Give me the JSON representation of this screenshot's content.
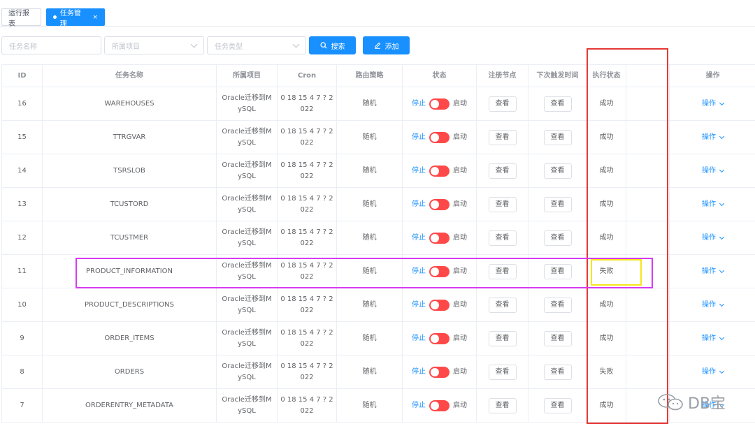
{
  "tabs": [
    {
      "label": "运行报表",
      "active": false
    },
    {
      "label": "任务管理",
      "active": true,
      "close": "×"
    }
  ],
  "filters": {
    "name_placeholder": "任务名称",
    "project_placeholder": "所属项目",
    "type_placeholder": "任务类型",
    "search_label": "搜索",
    "add_label": "添加"
  },
  "table": {
    "headers": {
      "id": "ID",
      "name": "任务名称",
      "project": "所属项目",
      "cron": "Cron",
      "route": "路由策略",
      "status": "状态",
      "reg": "注册节点",
      "next": "下次触发时间",
      "exec": "执行状态",
      "op": "操作"
    },
    "rows": [
      {
        "id": "16",
        "name": "WAREHOUSES",
        "project_l1": "Oracle迁移到M",
        "project_l2": "ySQL",
        "cron_l1": "0 18 15 4 7 ? 2",
        "cron_l2": "022",
        "route": "随机",
        "stop": "停止",
        "start": "启动",
        "reg": "查看",
        "next": "查看",
        "exec": "成功",
        "op": "操作"
      },
      {
        "id": "15",
        "name": "TTRGVAR",
        "project_l1": "Oracle迁移到M",
        "project_l2": "ySQL",
        "cron_l1": "0 18 15 4 7 ? 2",
        "cron_l2": "022",
        "route": "随机",
        "stop": "停止",
        "start": "启动",
        "reg": "查看",
        "next": "查看",
        "exec": "成功",
        "op": "操作"
      },
      {
        "id": "14",
        "name": "TSRSLOB",
        "project_l1": "Oracle迁移到M",
        "project_l2": "ySQL",
        "cron_l1": "0 18 15 4 7 ? 2",
        "cron_l2": "022",
        "route": "随机",
        "stop": "停止",
        "start": "启动",
        "reg": "查看",
        "next": "查看",
        "exec": "成功",
        "op": "操作"
      },
      {
        "id": "13",
        "name": "TCUSTORD",
        "project_l1": "Oracle迁移到M",
        "project_l2": "ySQL",
        "cron_l1": "0 18 15 4 7 ? 2",
        "cron_l2": "022",
        "route": "随机",
        "stop": "停止",
        "start": "启动",
        "reg": "查看",
        "next": "查看",
        "exec": "成功",
        "op": "操作"
      },
      {
        "id": "12",
        "name": "TCUSTMER",
        "project_l1": "Oracle迁移到M",
        "project_l2": "ySQL",
        "cron_l1": "0 18 15 4 7 ? 2",
        "cron_l2": "022",
        "route": "随机",
        "stop": "停止",
        "start": "启动",
        "reg": "查看",
        "next": "查看",
        "exec": "成功",
        "op": "操作"
      },
      {
        "id": "11",
        "name": "PRODUCT_INFORMATION",
        "project_l1": "Oracle迁移到M",
        "project_l2": "ySQL",
        "cron_l1": "0 18 15 4 7 ? 2",
        "cron_l2": "022",
        "route": "随机",
        "stop": "停止",
        "start": "启动",
        "reg": "查看",
        "next": "查看",
        "exec": "失败",
        "op": "操作"
      },
      {
        "id": "10",
        "name": "PRODUCT_DESCRIPTIONS",
        "project_l1": "Oracle迁移到M",
        "project_l2": "ySQL",
        "cron_l1": "0 18 15 4 7 ? 2",
        "cron_l2": "022",
        "route": "随机",
        "stop": "停止",
        "start": "启动",
        "reg": "查看",
        "next": "查看",
        "exec": "成功",
        "op": "操作"
      },
      {
        "id": "9",
        "name": "ORDER_ITEMS",
        "project_l1": "Oracle迁移到M",
        "project_l2": "ySQL",
        "cron_l1": "0 18 15 4 7 ? 2",
        "cron_l2": "022",
        "route": "随机",
        "stop": "停止",
        "start": "启动",
        "reg": "查看",
        "next": "查看",
        "exec": "成功",
        "op": "操作"
      },
      {
        "id": "8",
        "name": "ORDERS",
        "project_l1": "Oracle迁移到M",
        "project_l2": "ySQL",
        "cron_l1": "0 18 15 4 7 ? 2",
        "cron_l2": "022",
        "route": "随机",
        "stop": "停止",
        "start": "启动",
        "reg": "查看",
        "next": "查看",
        "exec": "失败",
        "op": "操作"
      },
      {
        "id": "7",
        "name": "ORDERENTRY_METADATA",
        "project_l1": "Oracle迁移到M",
        "project_l2": "ySQL",
        "cron_l1": "0 18 15 4 7 ? 2",
        "cron_l2": "022",
        "route": "随机",
        "stop": "停止",
        "start": "启动",
        "reg": "查看",
        "next": "查看",
        "exec": "成功",
        "op": "操作"
      }
    ]
  },
  "watermark": {
    "text": "DB宝",
    "icon": "wechat-icon"
  },
  "colors": {
    "primary": "#1890ff",
    "switch_off": "#ff4949",
    "highlight_red": "#e53935",
    "highlight_pink": "#d63bf0",
    "highlight_yellow": "#f5e61a"
  }
}
